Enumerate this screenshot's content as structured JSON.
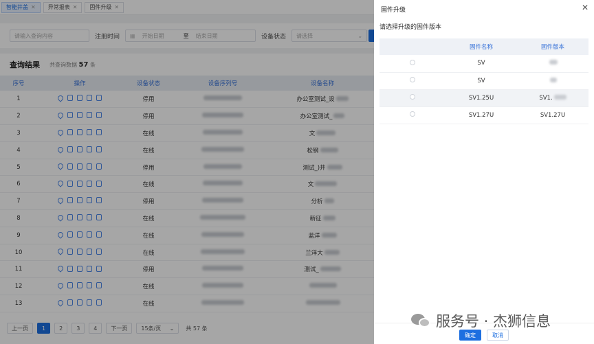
{
  "tabs": [
    {
      "label": "智能井盖",
      "active": true
    },
    {
      "label": "异常报表",
      "active": false
    },
    {
      "label": "固件升级",
      "active": false
    }
  ],
  "search": {
    "keyword_placeholder": "请输入查询内容",
    "reg_time_label": "注册时间",
    "start_placeholder": "开始日期",
    "range_sep": "至",
    "end_placeholder": "结束日期",
    "status_label": "设备状态",
    "status_placeholder": "请选择"
  },
  "results": {
    "title": "查询结果",
    "count_prefix": "共查询数据",
    "count_value": "57",
    "count_suffix": "条",
    "columns": [
      "序号",
      "操作",
      "设备状态",
      "设备序列号",
      "设备名称"
    ],
    "rows": [
      {
        "no": "1",
        "status": "停用",
        "name": "办公室测试_设"
      },
      {
        "no": "2",
        "status": "停用",
        "name": "办公室测试_"
      },
      {
        "no": "3",
        "status": "在线",
        "name": "文"
      },
      {
        "no": "4",
        "status": "在线",
        "name": "松钢"
      },
      {
        "no": "5",
        "status": "停用",
        "name": "测试_)井"
      },
      {
        "no": "6",
        "status": "在线",
        "name": "文"
      },
      {
        "no": "7",
        "status": "停用",
        "name": "分析"
      },
      {
        "no": "8",
        "status": "在线",
        "name": "新征"
      },
      {
        "no": "9",
        "status": "在线",
        "name": "蓝洋"
      },
      {
        "no": "10",
        "status": "在线",
        "name": "兰洋大"
      },
      {
        "no": "11",
        "status": "停用",
        "name": "测试_"
      },
      {
        "no": "12",
        "status": "在线",
        "name": ""
      },
      {
        "no": "13",
        "status": "在线",
        "name": ""
      }
    ]
  },
  "pager": {
    "prev": "上一页",
    "pages": [
      "1",
      "2",
      "3",
      "4"
    ],
    "next": "下一页",
    "page_size": "15条/页",
    "total": "共 57 条"
  },
  "drawer": {
    "title": "固件升级",
    "prompt": "请选择升级的固件版本",
    "columns": [
      "固件名称",
      "固件版本"
    ],
    "rows": [
      {
        "name": "SV",
        "version": ""
      },
      {
        "name": "SV",
        "version": ""
      },
      {
        "name": "SV1.25U",
        "version": "SV1."
      },
      {
        "name": "SV1.27U",
        "version": "SV1.27U"
      }
    ],
    "ok": "确定",
    "cancel": "取消"
  },
  "watermark": "服务号 · 杰狮信息",
  "colors": {
    "primary": "#1d6fe0",
    "online": "#2ca02c",
    "header_text": "#3a74d9"
  }
}
